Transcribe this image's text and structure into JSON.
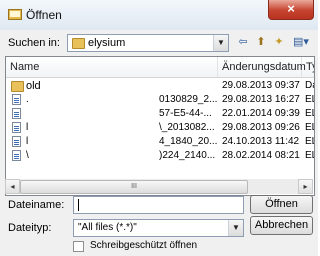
{
  "window": {
    "title": "Öffnen",
    "close_symbol": "×"
  },
  "lookin": {
    "label": "Suchen in:",
    "value": "elysium"
  },
  "columns": {
    "name": "Name",
    "date": "Änderungsdatum",
    "type": "Ty"
  },
  "files": [
    {
      "name": "old",
      "date": "29.08.2013 09:37",
      "type": "Da",
      "is_folder": true
    },
    {
      "name": ".",
      "mid": "0130829_2...",
      "date": "29.08.2013 16:27",
      "type": "EL"
    },
    {
      "name": "",
      "mid": "57-E5-44-...",
      "date": "22.01.2014 09:39",
      "type": "EL"
    },
    {
      "name": "l",
      "mid": "\\_2013082...",
      "date": "29.08.2013 09:26",
      "type": "EL"
    },
    {
      "name": "l",
      "mid": "4_1840_20...",
      "date": "24.10.2013 11:42",
      "type": "EL"
    },
    {
      "name": "\\",
      "mid": ")224_2140...",
      "date": "28.02.2014 08:21",
      "type": "EL"
    }
  ],
  "scroll": {
    "thumb_label": "III",
    "left_arrow": "◂",
    "right_arrow": "▸"
  },
  "filename": {
    "label": "Dateiname:",
    "value": ""
  },
  "filetype": {
    "label": "Dateityp:",
    "value": "\"All files (*.*)\""
  },
  "buttons": {
    "open": "Öffnen",
    "cancel": "Abbrechen"
  },
  "readonly": {
    "label": "Schreibgeschützt öffnen"
  }
}
